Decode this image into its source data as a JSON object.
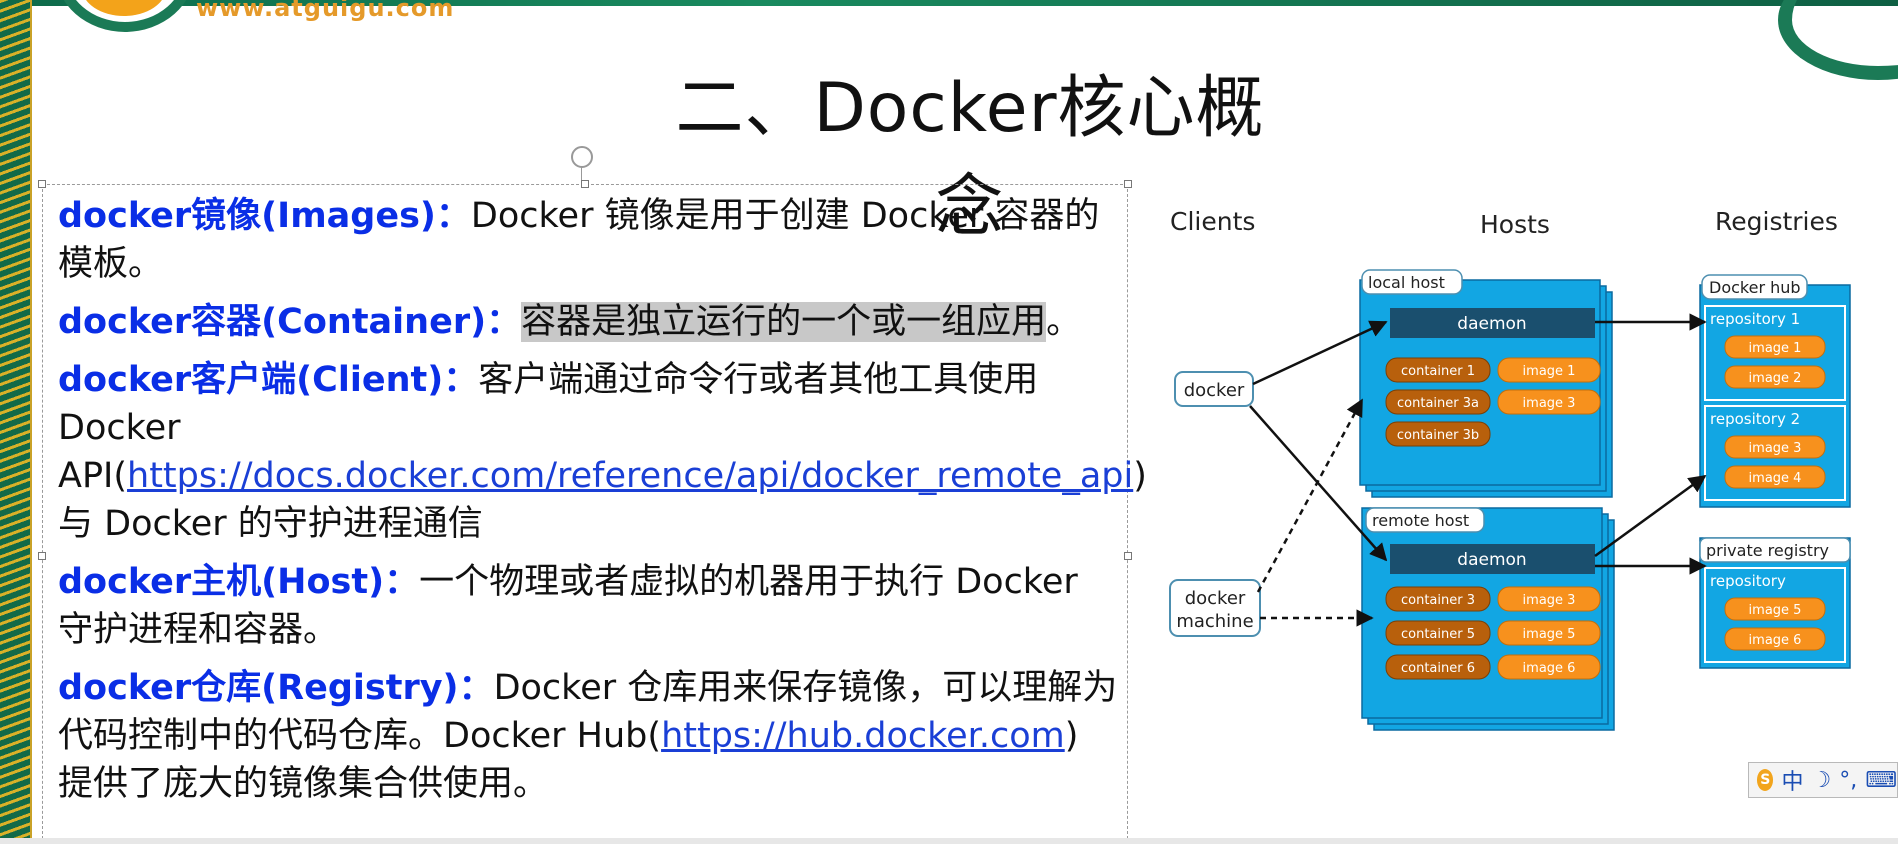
{
  "logo": {
    "url_text": "www.atguigu.com"
  },
  "title": "二、Docker核心概念",
  "paragraphs": [
    {
      "term": "docker镜像(Images)：",
      "text": "Docker 镜像是用于创建 Docker 容器的模板。"
    },
    {
      "term": "docker容器(Container)：",
      "highlight": "容器是独立运行的一个或一组应用",
      "tail": "。"
    },
    {
      "term": "docker客户端(Client)：",
      "pre": "客户端通过命令行或者其他工具使用 Docker API(",
      "link": "https://docs.docker.com/reference/api/docker_remote_api",
      "post": ") 与 Docker 的守护进程通信"
    },
    {
      "term": "docker主机(Host)：",
      "text": "一个物理或者虚拟的机器用于执行 Docker 守护进程和容器。"
    },
    {
      "term": "docker仓库(Registry)：",
      "pre": "Docker 仓库用来保存镜像，可以理解为代码控制中的代码仓库。Docker Hub(",
      "link": "https://hub.docker.com",
      "post": ") 提供了庞大的镜像集合供使用。"
    }
  ],
  "diagram": {
    "columns": {
      "clients": "Clients",
      "hosts": "Hosts",
      "registries": "Registries"
    },
    "clients": {
      "docker": "docker",
      "docker_machine_1": "docker",
      "docker_machine_2": "machine"
    },
    "local_host": {
      "label": "local host",
      "daemon": "daemon",
      "containers": [
        "container 1",
        "container 3a",
        "container 3b"
      ],
      "images": [
        "image 1",
        "image 3"
      ]
    },
    "remote_host": {
      "label": "remote host",
      "daemon": "daemon",
      "containers": [
        "container 3",
        "container 5",
        "container 6"
      ],
      "images": [
        "image 3",
        "image 5",
        "image 6"
      ]
    },
    "docker_hub": {
      "label": "Docker hub",
      "repo1": {
        "label": "repository 1",
        "images": [
          "image 1",
          "image 2"
        ]
      },
      "repo2": {
        "label": "repository 2",
        "images": [
          "image 3",
          "image 4"
        ]
      }
    },
    "private_registry": {
      "label": "private registry",
      "repo": {
        "label": "repository",
        "images": [
          "image 5",
          "image 6"
        ]
      }
    },
    "colors": {
      "host_blue": "#12a6e3",
      "daemon_dark": "#1a4f6e",
      "container_brown": "#b8600c",
      "image_orange": "#f7911d",
      "text_white": "#ffffff"
    }
  },
  "tray": {
    "ime_char": "中",
    "moon": "☽",
    "punct": "°,",
    "keyboard": "⌨"
  }
}
